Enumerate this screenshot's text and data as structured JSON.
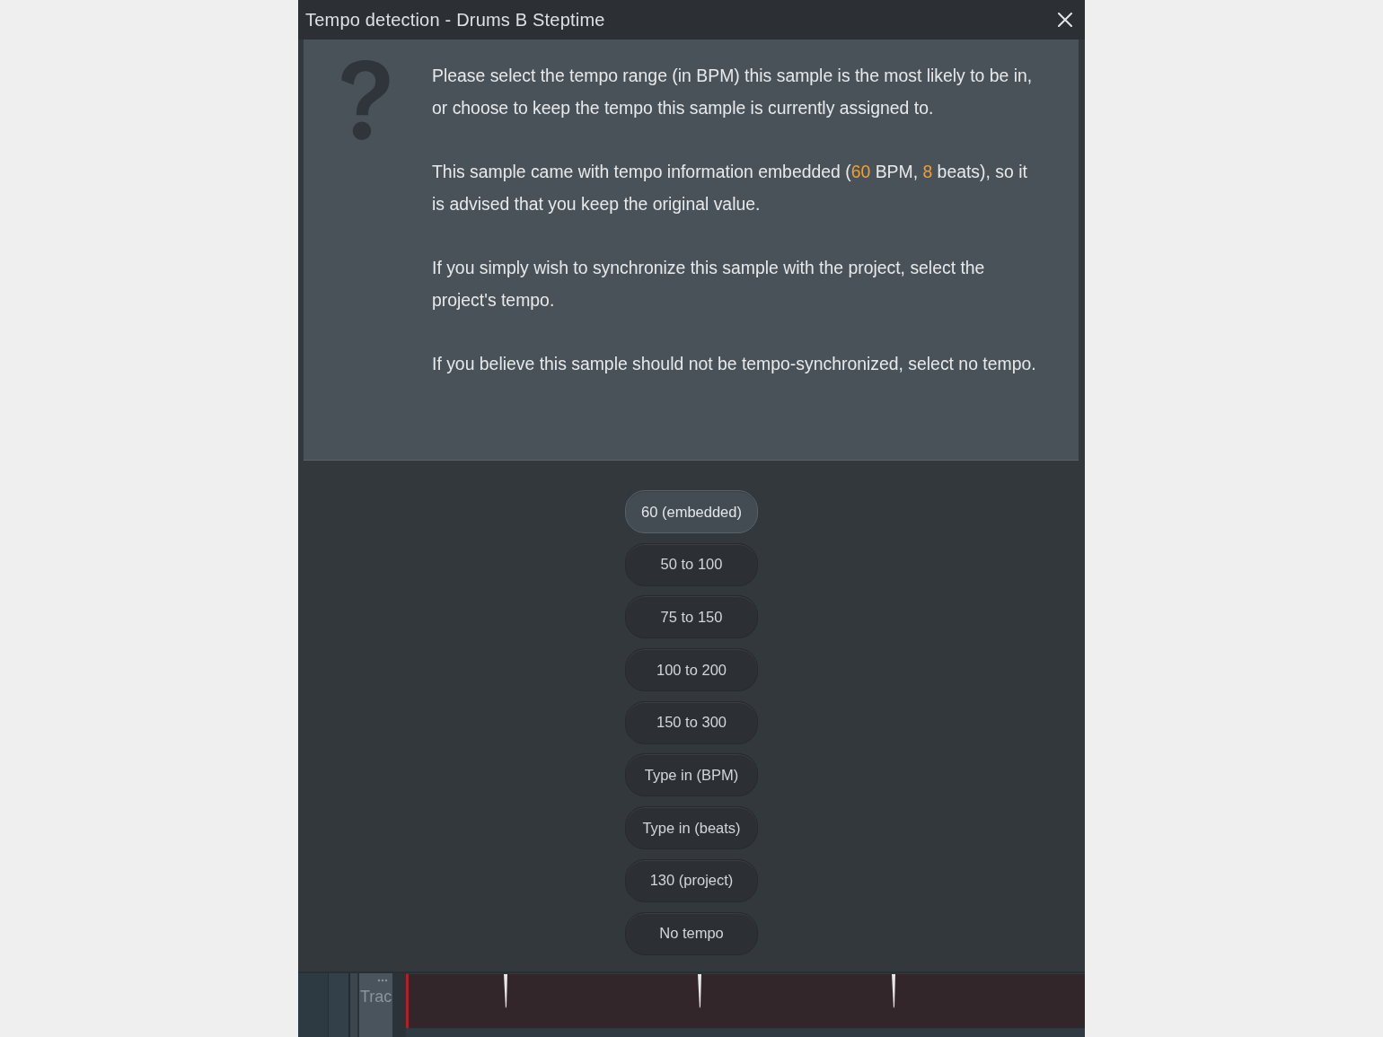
{
  "window": {
    "title": "Tempo detection - Drums B Steptime"
  },
  "message": {
    "paragraphs": [
      {
        "segments": [
          {
            "text": "Please select the tempo range (in BPM) this sample is the most likely to be in, or choose to keep the tempo this sample is currently assigned to.",
            "highlight": false
          }
        ]
      },
      {
        "segments": [
          {
            "text": "This sample came with tempo information embedded (",
            "highlight": false
          },
          {
            "text": "60",
            "highlight": true
          },
          {
            "text": " BPM, ",
            "highlight": false
          },
          {
            "text": "8",
            "highlight": true
          },
          {
            "text": " beats), so it is advised that you keep the original value.",
            "highlight": false
          }
        ]
      },
      {
        "segments": [
          {
            "text": "If you simply wish to synchronize this sample with the project, select the project's tempo.",
            "highlight": false
          }
        ]
      },
      {
        "segments": [
          {
            "text": "If you believe this sample should not be tempo-synchronized, select no tempo.",
            "highlight": false
          }
        ]
      }
    ]
  },
  "options": [
    {
      "label": "60 (embedded)",
      "selected": true
    },
    {
      "label": "50 to 100",
      "selected": false
    },
    {
      "label": "75 to 150",
      "selected": false
    },
    {
      "label": "100 to 200",
      "selected": false
    },
    {
      "label": "150 to 300",
      "selected": false
    },
    {
      "label": "Type in (BPM)",
      "selected": false
    },
    {
      "label": "Type in (beats)",
      "selected": false
    },
    {
      "label": "130 (project)",
      "selected": false
    },
    {
      "label": "No tempo",
      "selected": false
    }
  ],
  "background_track": {
    "label": "Trac"
  }
}
